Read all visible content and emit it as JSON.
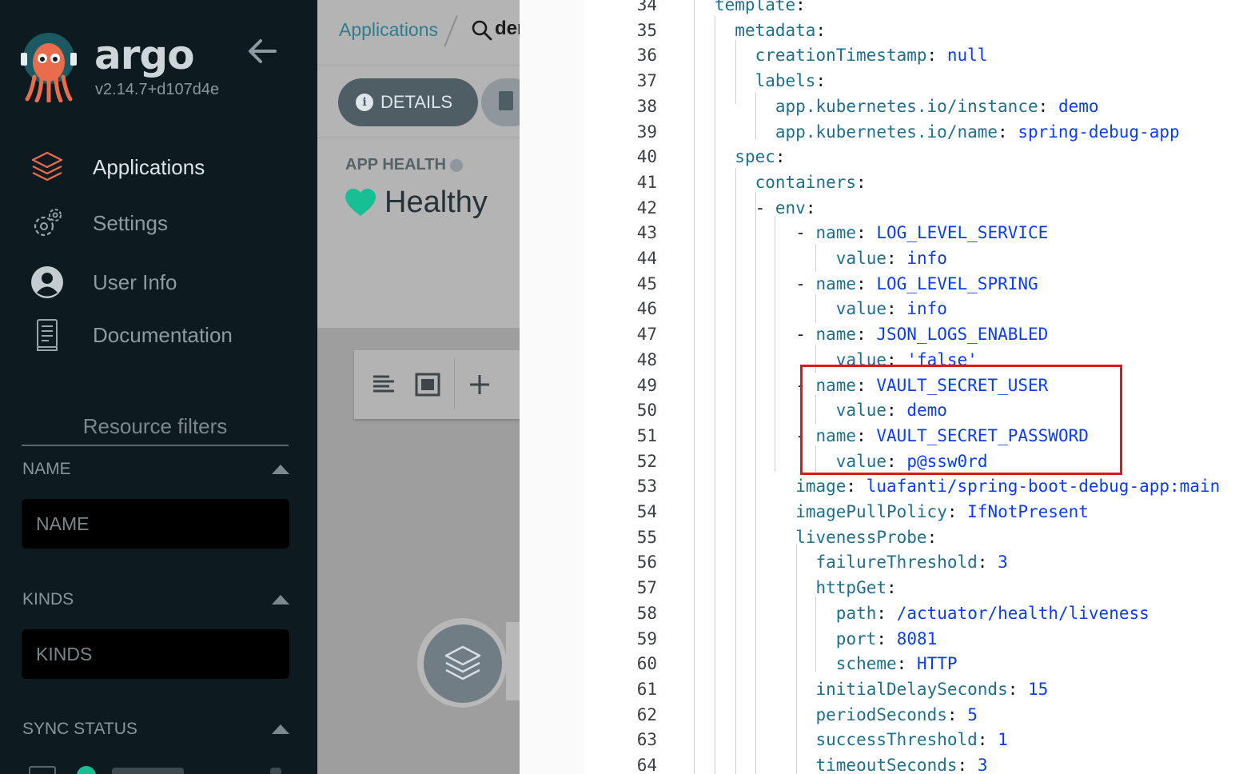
{
  "app": {
    "name": "argo",
    "version": "v2.14.7+d107d4e"
  },
  "sidebar": {
    "nav": [
      {
        "label": "Applications",
        "icon": "layers-icon",
        "active": true
      },
      {
        "label": "Settings",
        "icon": "gear-icon",
        "active": false
      },
      {
        "label": "User Info",
        "icon": "user-icon",
        "active": false
      },
      {
        "label": "Documentation",
        "icon": "book-icon",
        "active": false
      }
    ],
    "filters_title": "Resource filters",
    "filters": {
      "name": {
        "title": "NAME",
        "placeholder": "NAME"
      },
      "kinds": {
        "title": "KINDS",
        "placeholder": "KINDS"
      },
      "sync": {
        "title": "SYNC STATUS"
      }
    }
  },
  "header": {
    "breadcrumb_link": "Applications",
    "search_text": "der"
  },
  "details": {
    "button_label": "DETAILS",
    "health_label": "APP HEALTH",
    "health_value": "Healthy"
  },
  "colors": {
    "sidebar_bg": "#0d1b21",
    "accent_orange": "#e96d4c",
    "healthy_green": "#18be94",
    "yaml_key": "#1f6f8b",
    "yaml_value": "#0d3df2",
    "highlight_red": "#e0161b"
  },
  "yaml_lines": [
    {
      "n": "34",
      "indent": 0,
      "key": "template",
      "value": ""
    },
    {
      "n": "35",
      "indent": 1,
      "key": "metadata",
      "value": ""
    },
    {
      "n": "36",
      "indent": 2,
      "key": "creationTimestamp",
      "value": "null"
    },
    {
      "n": "37",
      "indent": 2,
      "key": "labels",
      "value": ""
    },
    {
      "n": "38",
      "indent": 3,
      "key": "app.kubernetes.io/instance",
      "value": "demo"
    },
    {
      "n": "39",
      "indent": 3,
      "key": "app.kubernetes.io/name",
      "value": "spring-debug-app"
    },
    {
      "n": "40",
      "indent": 1,
      "key": "spec",
      "value": ""
    },
    {
      "n": "41",
      "indent": 2,
      "key": "containers",
      "value": ""
    },
    {
      "n": "42",
      "indent": 3,
      "dash": true,
      "key": "env",
      "value": ""
    },
    {
      "n": "43",
      "indent": 5,
      "dash": true,
      "key": "name",
      "value": "LOG_LEVEL_SERVICE"
    },
    {
      "n": "44",
      "indent": 6,
      "key": "value",
      "value": "info"
    },
    {
      "n": "45",
      "indent": 5,
      "dash": true,
      "key": "name",
      "value": "LOG_LEVEL_SPRING"
    },
    {
      "n": "46",
      "indent": 6,
      "key": "value",
      "value": "info"
    },
    {
      "n": "47",
      "indent": 5,
      "dash": true,
      "key": "name",
      "value": "JSON_LOGS_ENABLED"
    },
    {
      "n": "48",
      "indent": 6,
      "key": "value",
      "value": "'false'"
    },
    {
      "n": "49",
      "indent": 5,
      "dash": true,
      "key": "name",
      "value": "VAULT_SECRET_USER"
    },
    {
      "n": "50",
      "indent": 6,
      "key": "value",
      "value": "demo"
    },
    {
      "n": "51",
      "indent": 5,
      "dash": true,
      "key": "name",
      "value": "VAULT_SECRET_PASSWORD"
    },
    {
      "n": "52",
      "indent": 6,
      "key": "value",
      "value": "p@ssw0rd"
    },
    {
      "n": "53",
      "indent": 4,
      "key": "image",
      "value": "luafanti/spring-boot-debug-app:main"
    },
    {
      "n": "54",
      "indent": 4,
      "key": "imagePullPolicy",
      "value": "IfNotPresent"
    },
    {
      "n": "55",
      "indent": 4,
      "key": "livenessProbe",
      "value": ""
    },
    {
      "n": "56",
      "indent": 5,
      "key": "failureThreshold",
      "value": "3"
    },
    {
      "n": "57",
      "indent": 5,
      "key": "httpGet",
      "value": ""
    },
    {
      "n": "58",
      "indent": 6,
      "key": "path",
      "value": "/actuator/health/liveness"
    },
    {
      "n": "59",
      "indent": 6,
      "key": "port",
      "value": "8081"
    },
    {
      "n": "60",
      "indent": 6,
      "key": "scheme",
      "value": "HTTP"
    },
    {
      "n": "61",
      "indent": 5,
      "key": "initialDelaySeconds",
      "value": "15"
    },
    {
      "n": "62",
      "indent": 5,
      "key": "periodSeconds",
      "value": "5"
    },
    {
      "n": "63",
      "indent": 5,
      "key": "successThreshold",
      "value": "1"
    },
    {
      "n": "64",
      "indent": 5,
      "key": "timeoutSeconds",
      "value": "3"
    }
  ]
}
